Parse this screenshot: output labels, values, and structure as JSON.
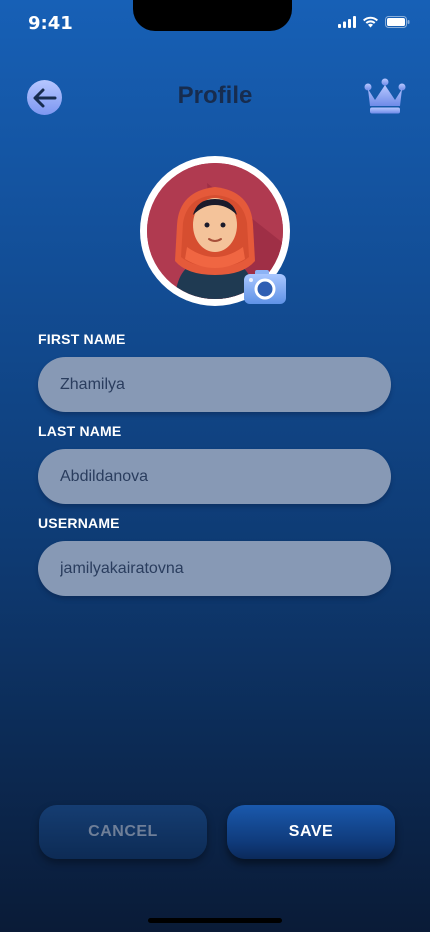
{
  "status_bar": {
    "time": "9:41",
    "icons": [
      "signal-icon",
      "wifi-icon",
      "battery-icon"
    ]
  },
  "header": {
    "title": "Profile",
    "back_icon": "arrow-left-icon",
    "crown_icon": "crown-icon"
  },
  "avatar": {
    "icon": "avatar-illustration",
    "camera_icon": "camera-icon"
  },
  "form": {
    "first_name": {
      "label": "FIRST NAME",
      "value": "Zhamilya"
    },
    "last_name": {
      "label": "LAST NAME",
      "value": "Abdildanova"
    },
    "username": {
      "label": "USERNAME",
      "value": "jamilyakairatovna"
    }
  },
  "actions": {
    "cancel_label": "CANCEL",
    "save_label": "SAVE"
  },
  "colors": {
    "background_top": "#1760b6",
    "background_bottom": "#0a1b37",
    "input_fill": "#8799b5",
    "title": "#172c4e",
    "accent": "#7d97f1"
  }
}
